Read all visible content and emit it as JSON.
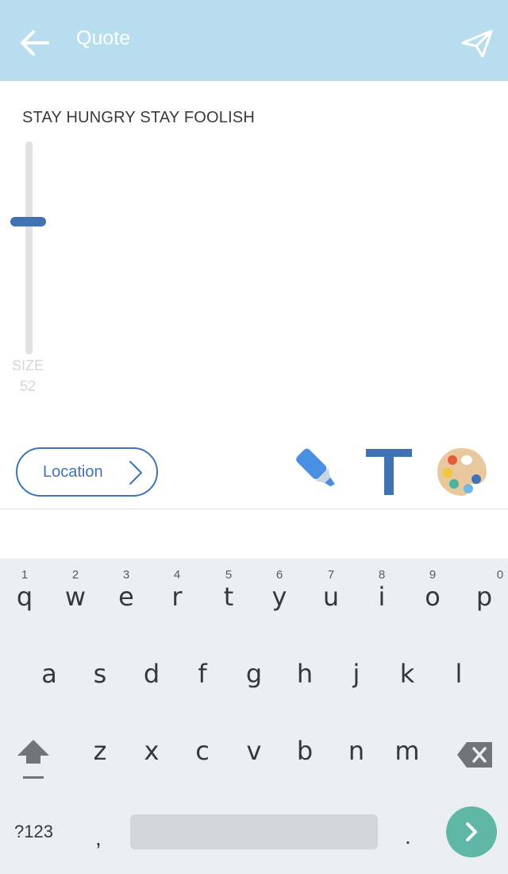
{
  "header": {
    "title": "Quote",
    "back_icon": "arrow-left-icon",
    "send_icon": "paper-plane-icon",
    "background": "#b7ddee"
  },
  "editor": {
    "quote_text": "STAY HUNGRY STAY FOOLISH",
    "size_label": "SIZE",
    "size_value": "52",
    "accent": "#3f73b5"
  },
  "toolbar": {
    "location_label": "Location",
    "highlighter_icon": "highlighter-icon",
    "text_icon": "text-format-icon",
    "palette_icon": "color-palette-icon"
  },
  "keyboard": {
    "row1": [
      {
        "letter": "q",
        "hint": "1"
      },
      {
        "letter": "w",
        "hint": "2"
      },
      {
        "letter": "e",
        "hint": "3"
      },
      {
        "letter": "r",
        "hint": "4"
      },
      {
        "letter": "t",
        "hint": "5"
      },
      {
        "letter": "y",
        "hint": "6"
      },
      {
        "letter": "u",
        "hint": "7"
      },
      {
        "letter": "i",
        "hint": "8"
      },
      {
        "letter": "o",
        "hint": "9"
      },
      {
        "letter": "p",
        "hint": "0"
      }
    ],
    "row2": [
      "a",
      "s",
      "d",
      "f",
      "g",
      "h",
      "j",
      "k",
      "l"
    ],
    "row3": [
      "z",
      "x",
      "c",
      "v",
      "b",
      "n",
      "m"
    ],
    "symbols_label": "?123",
    "comma": ",",
    "period": ".",
    "enter_color": "#5fb7a5"
  }
}
